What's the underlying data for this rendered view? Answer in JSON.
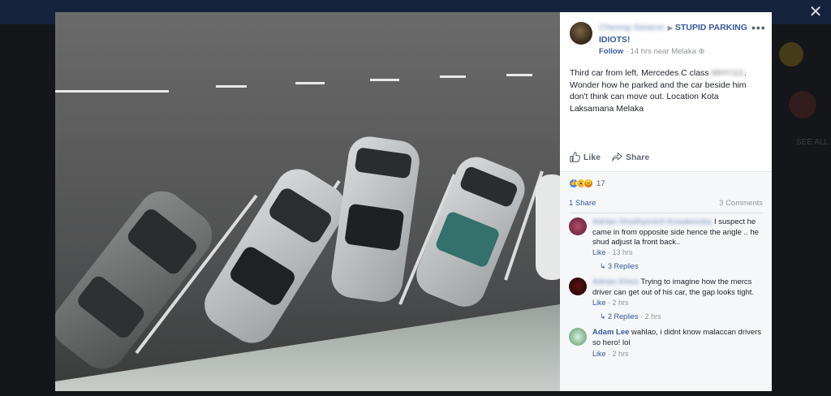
{
  "lightbox": {
    "close_glyph": "✕"
  },
  "post": {
    "author_name": "Cheong Siewcer",
    "group_name": "STUPID PARKING IDIOTS!",
    "more_glyph": "•••",
    "follow_label": "Follow",
    "time_location": "14 hrs near Melaka",
    "text_part1": "Third car from left. Mercedes C class",
    "text_blurred": "WHY111",
    "text_part2": ". Wonder how he parked and the car beside him don't think can move out. Location Kota Laksamana Melaka"
  },
  "actions": {
    "like_label": "Like",
    "share_label": "Share"
  },
  "reactions": {
    "count": "17",
    "shares": "1 Share",
    "comments_count": "3 Comments",
    "colors": {
      "like": "#4080ff",
      "haha": "#f7b125",
      "angry": "#e9710f"
    }
  },
  "comments": [
    {
      "author": "Adrian Onathyevich Kosakevsky",
      "text": "I suspect he came in from opposite side hence the angle .. he shud adjust la front back..",
      "like_label": "Like",
      "time": "13 hrs",
      "replies_label": "3 Replies",
      "replies_time": ""
    },
    {
      "author": "Adrian Khoo",
      "text": "Trying to imagine how the mercs driver can get out of his car, the gap looks tight.",
      "like_label": "Like",
      "time": "2 hrs",
      "replies_label": "2 Replies",
      "replies_time": "2 hrs"
    },
    {
      "author": "Adam Lee",
      "text": "wahlao, i didnt know malaccan drivers so hero! lol",
      "like_label": "Like",
      "time": "2 hrs"
    }
  ],
  "background": {
    "see_all": "SEE ALL"
  },
  "colors": {
    "link": "#365899",
    "meta": "#90949c",
    "panel_bg": "#ffffff",
    "overlay": "#0b0d12"
  }
}
